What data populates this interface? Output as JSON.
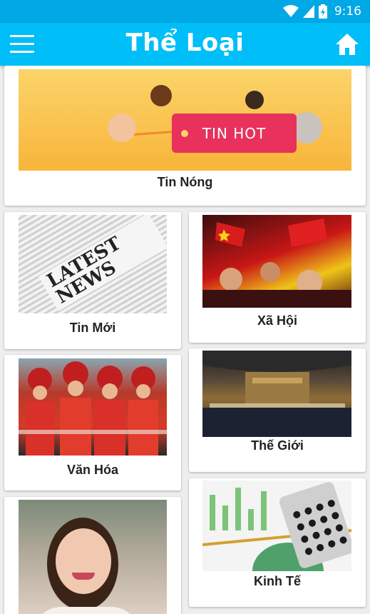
{
  "status_bar": {
    "time": "9:16"
  },
  "app_bar": {
    "title": "Thể Loại"
  },
  "banner": {
    "tag_text": "TIN HOT"
  },
  "categories": [
    {
      "label": "Tin Nóng"
    },
    {
      "label": "Tin Mới"
    },
    {
      "label": "Xã Hội"
    },
    {
      "label": "Văn Hóa"
    },
    {
      "label": "Thế Giới"
    },
    {
      "label": "Kinh Tế"
    }
  ],
  "news_thumb": {
    "headline": "LATEST NEWS"
  },
  "colors": {
    "status_bar": "#00a8e6",
    "app_bar": "#00bef8",
    "accent_tag": "#e8315c"
  }
}
